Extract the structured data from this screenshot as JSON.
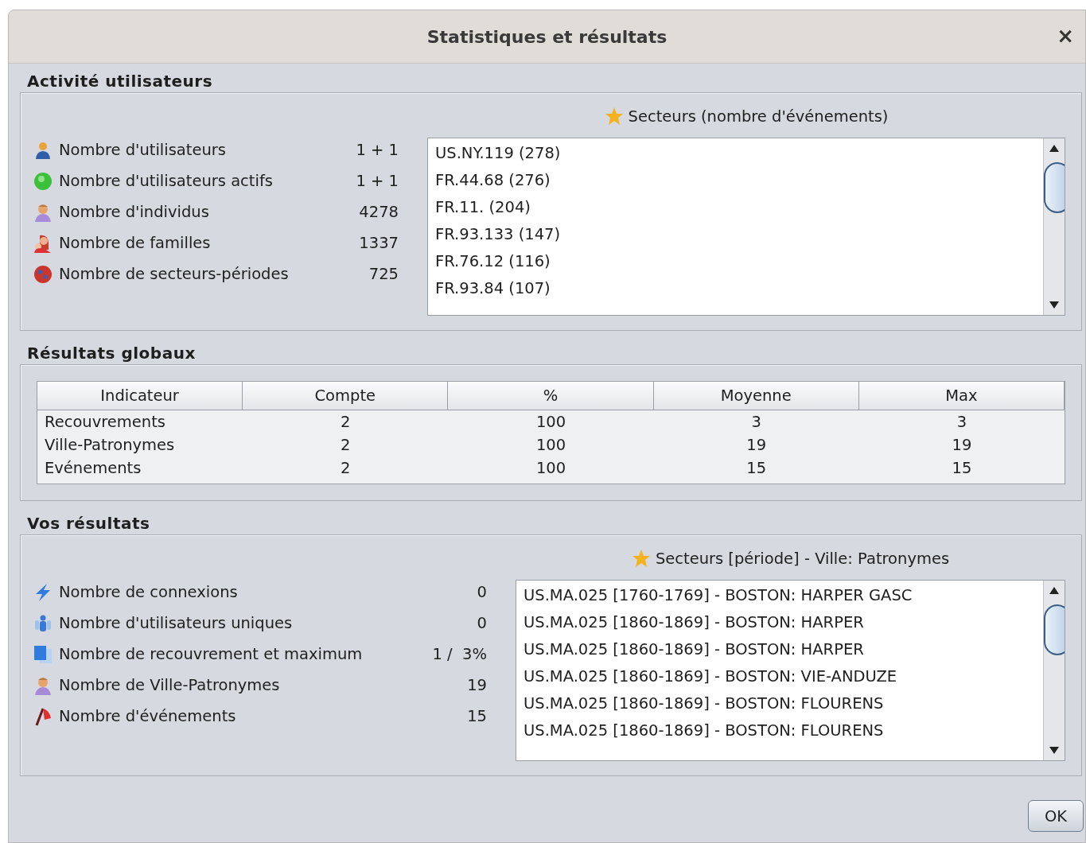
{
  "window": {
    "title": "Statistiques et résultats",
    "close": "×"
  },
  "activity": {
    "heading": "Activité utilisateurs",
    "stats": [
      {
        "kind": "user",
        "label": "Nombre d'utilisateurs",
        "value": "1 + 1"
      },
      {
        "kind": "active",
        "label": "Nombre d'utilisateurs actifs",
        "value": "1 + 1"
      },
      {
        "kind": "person",
        "label": "Nombre d'individus",
        "value": "4278"
      },
      {
        "kind": "family",
        "label": "Nombre de familles",
        "value": "1337"
      },
      {
        "kind": "globe",
        "label": "Nombre de secteurs-périodes",
        "value": "725"
      }
    ],
    "list_title": "Secteurs (nombre d'événements)",
    "list": [
      "US.NY.119 (278)",
      "FR.44.68 (276)",
      "FR.11. (204)",
      "FR.93.133 (147)",
      "FR.76.12 (116)",
      "FR.93.84 (107)"
    ]
  },
  "global": {
    "heading": "Résultats globaux",
    "columns": [
      "Indicateur",
      "Compte",
      "%",
      "Moyenne",
      "Max"
    ],
    "rows": [
      [
        "Recouvrements",
        "2",
        "100",
        "3",
        "3"
      ],
      [
        "Ville-Patronymes",
        "2",
        "100",
        "19",
        "19"
      ],
      [
        "Evénements",
        "2",
        "100",
        "15",
        "15"
      ]
    ]
  },
  "yours": {
    "heading": "Vos résultats",
    "stats": [
      {
        "kind": "bolt",
        "label": "Nombre de connexions",
        "value": "0"
      },
      {
        "kind": "people",
        "label": "Nombre d'utilisateurs uniques",
        "value": "0"
      },
      {
        "kind": "squares",
        "label": "Nombre de recouvrement et maximum",
        "value": "1 /  3%"
      },
      {
        "kind": "person",
        "label": "Nombre de Ville-Patronymes",
        "value": "19"
      },
      {
        "kind": "flag",
        "label": "Nombre d'événements",
        "value": "15"
      }
    ],
    "list_title": "Secteurs [période] - Ville: Patronymes",
    "list": [
      "US.MA.025 [1760-1769] - BOSTON: HARPER GASC",
      "US.MA.025 [1860-1869] - BOSTON: HARPER",
      "US.MA.025 [1860-1869] - BOSTON: HARPER",
      "US.MA.025 [1860-1869] - BOSTON: VIE-ANDUZE",
      "US.MA.025 [1860-1869] - BOSTON: FLOURENS",
      "US.MA.025 [1860-1869] - BOSTON: FLOURENS"
    ]
  },
  "buttons": [
    "OK"
  ]
}
